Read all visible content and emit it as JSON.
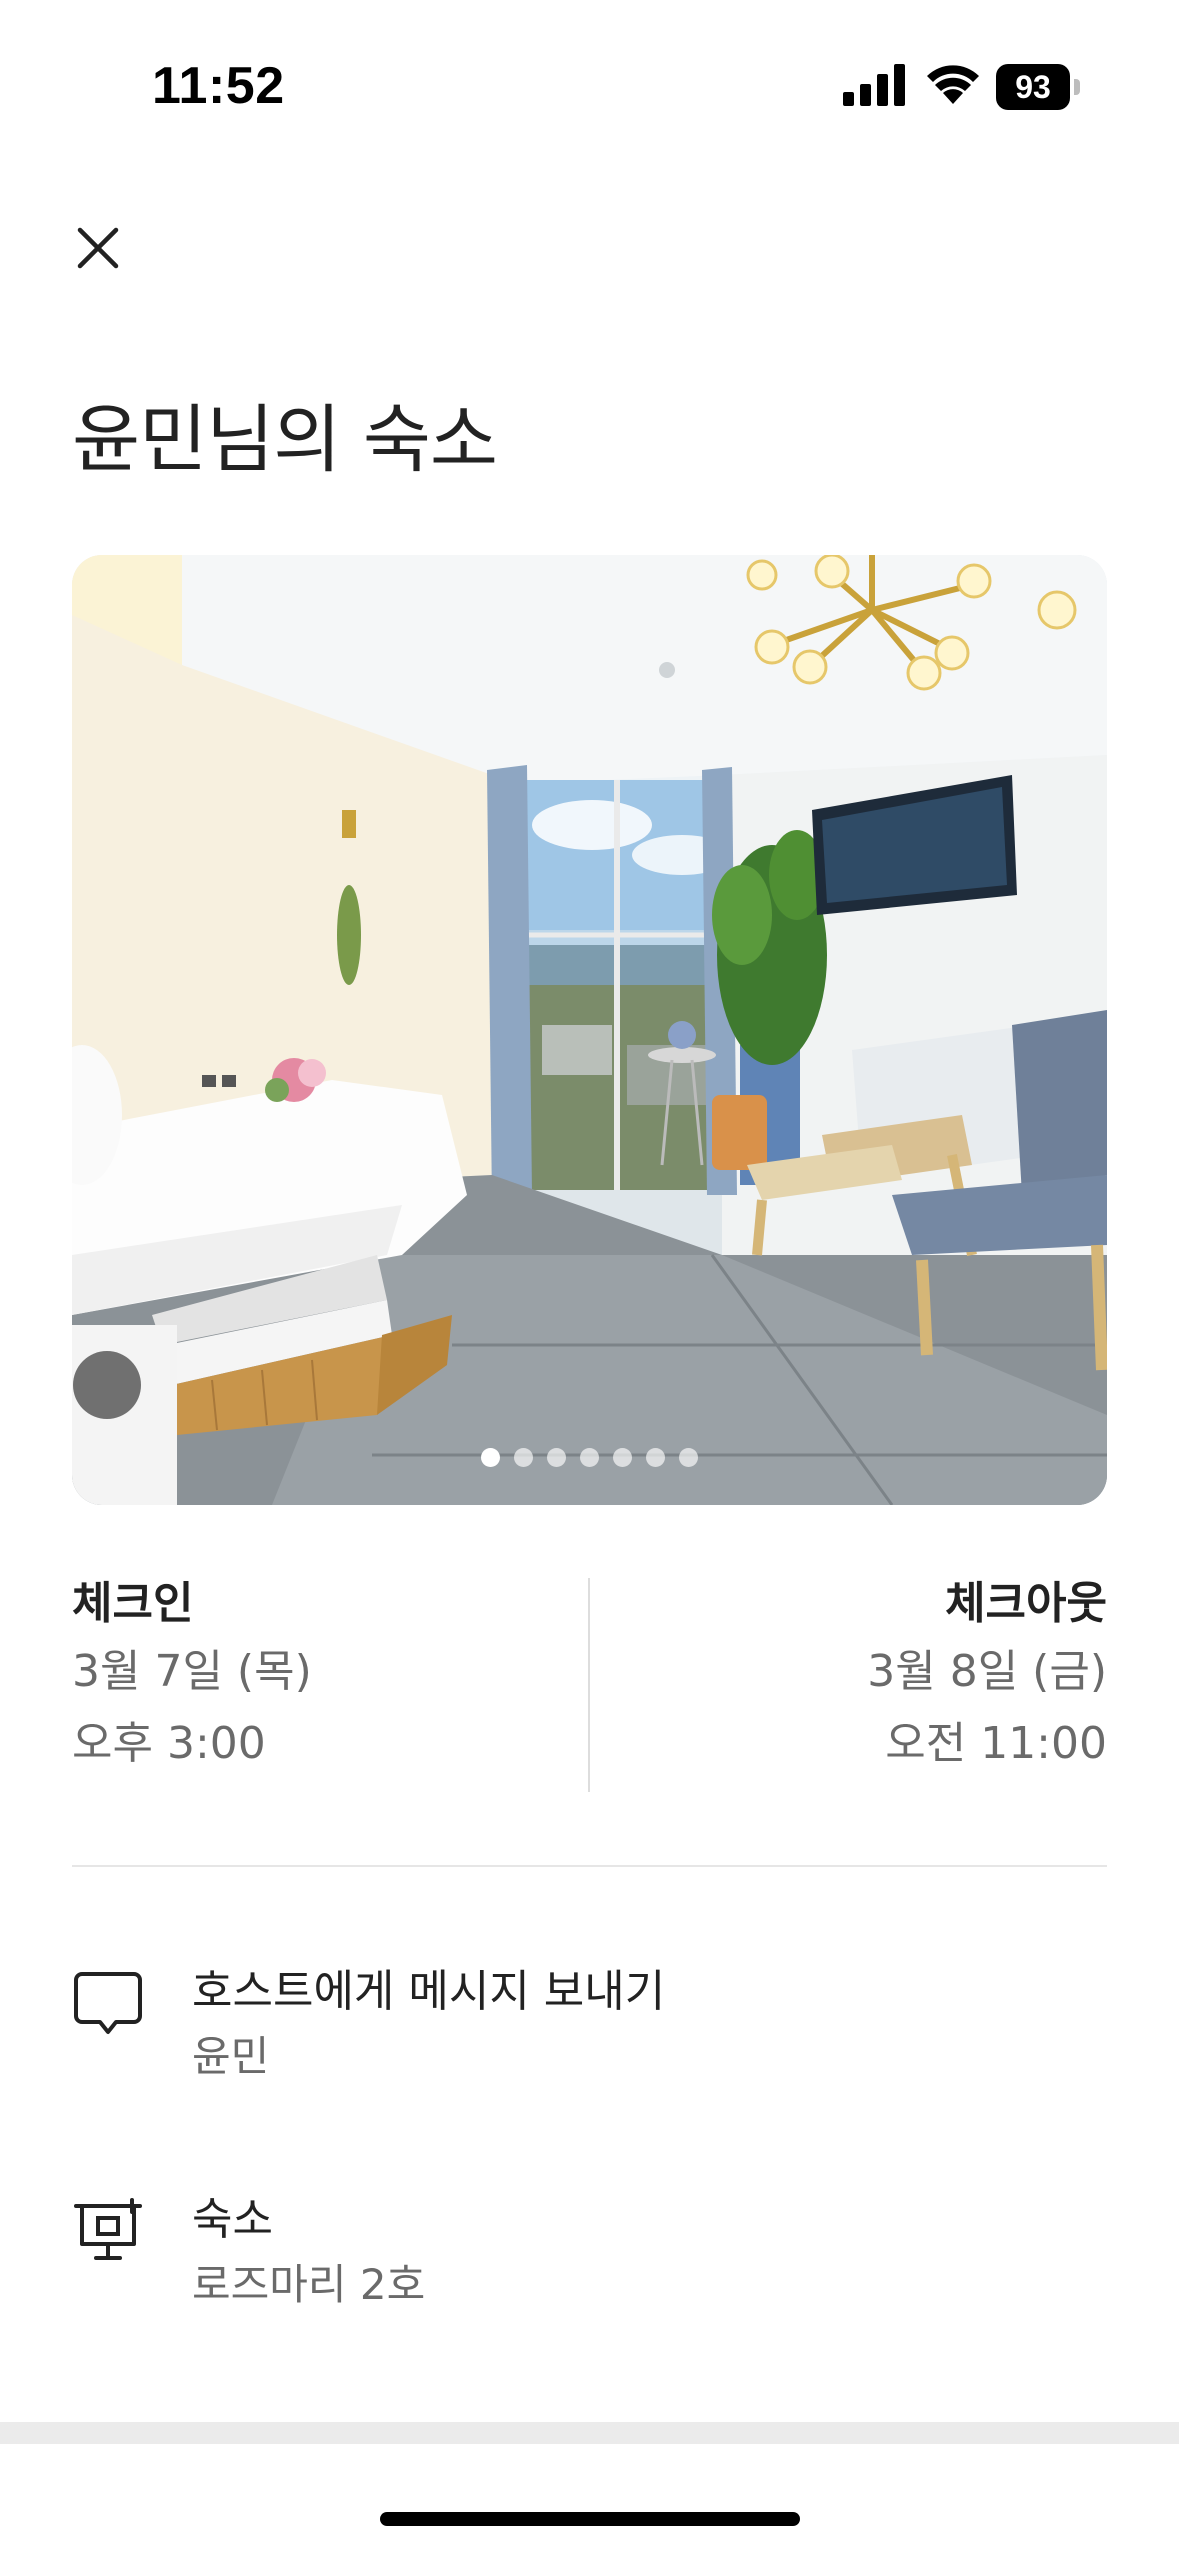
{
  "status_bar": {
    "time": "11:52",
    "battery": "93",
    "icons": [
      "cellular-signal-icon",
      "wifi-icon",
      "battery-icon"
    ]
  },
  "header": {
    "close_icon": "close-icon"
  },
  "title": "윤민님의 숙소",
  "photo": {
    "dot_count": 7,
    "active_index": 0
  },
  "checkin": {
    "label": "체크인",
    "date": "3월 7일 (목)",
    "time": "오후 3:00"
  },
  "checkout": {
    "label": "체크아웃",
    "date": "3월 8일 (금)",
    "time": "오전 11:00"
  },
  "rows": [
    {
      "icon": "message-bubble-icon",
      "title": "호스트에게 메시지 보내기",
      "subtitle": "윤민"
    },
    {
      "icon": "listing-icon",
      "title": "숙소",
      "subtitle": "로즈마리 2호"
    }
  ],
  "colors": {
    "text_primary": "#222222",
    "text_secondary": "#6a6a6a",
    "divider": "#e6e6e6"
  }
}
